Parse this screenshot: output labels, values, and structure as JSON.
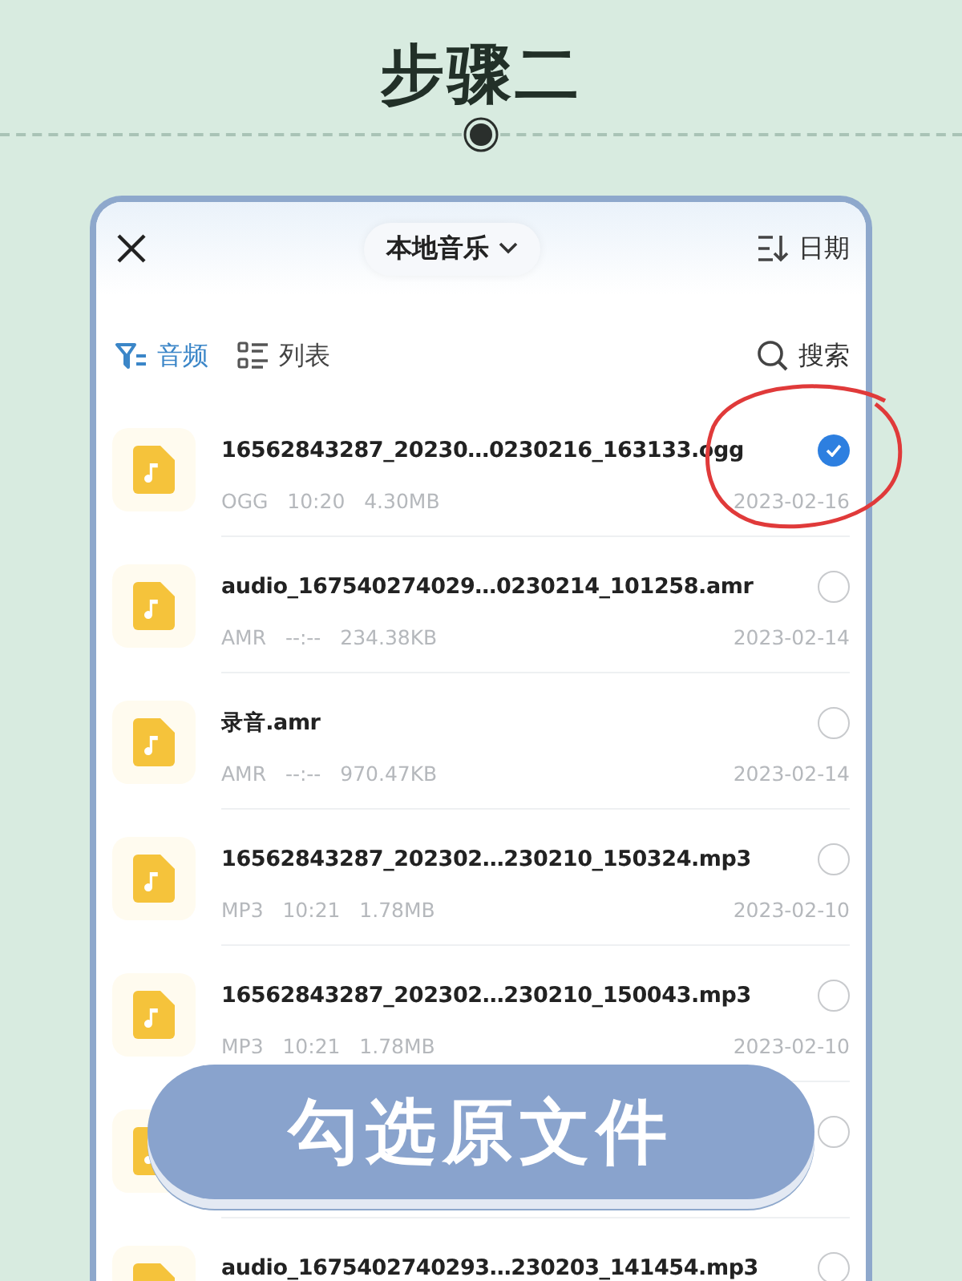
{
  "heading": "步骤二",
  "header": {
    "title": "本地音乐",
    "sort_label": "日期"
  },
  "tabs": [
    {
      "label": "音频",
      "selected": true,
      "kind": "filter"
    },
    {
      "label": "列表",
      "selected": false,
      "kind": "list"
    }
  ],
  "search": {
    "label": "搜索"
  },
  "files": [
    {
      "name": "16562843287_20230…0230216_163133.ogg",
      "type": "OGG",
      "duration": "10:20",
      "size": "4.30MB",
      "date": "2023-02-16",
      "selected": true
    },
    {
      "name": "audio_167540274029…0230214_101258.amr",
      "type": "AMR",
      "duration": "--:--",
      "size": "234.38KB",
      "date": "2023-02-14",
      "selected": false
    },
    {
      "name": "录音.amr",
      "type": "AMR",
      "duration": "--:--",
      "size": "970.47KB",
      "date": "2023-02-14",
      "selected": false
    },
    {
      "name": "16562843287_202302…230210_150324.mp3",
      "type": "MP3",
      "duration": "10:21",
      "size": "1.78MB",
      "date": "2023-02-10",
      "selected": false
    },
    {
      "name": "16562843287_202302…230210_150043.mp3",
      "type": "MP3",
      "duration": "10:21",
      "size": "1.78MB",
      "date": "2023-02-10",
      "selected": false
    },
    {
      "selected": false
    },
    {
      "name": "audio_1675402740293…230203_141454.mp3",
      "selected": false
    }
  ],
  "banner": {
    "text": "勾选原文件"
  }
}
